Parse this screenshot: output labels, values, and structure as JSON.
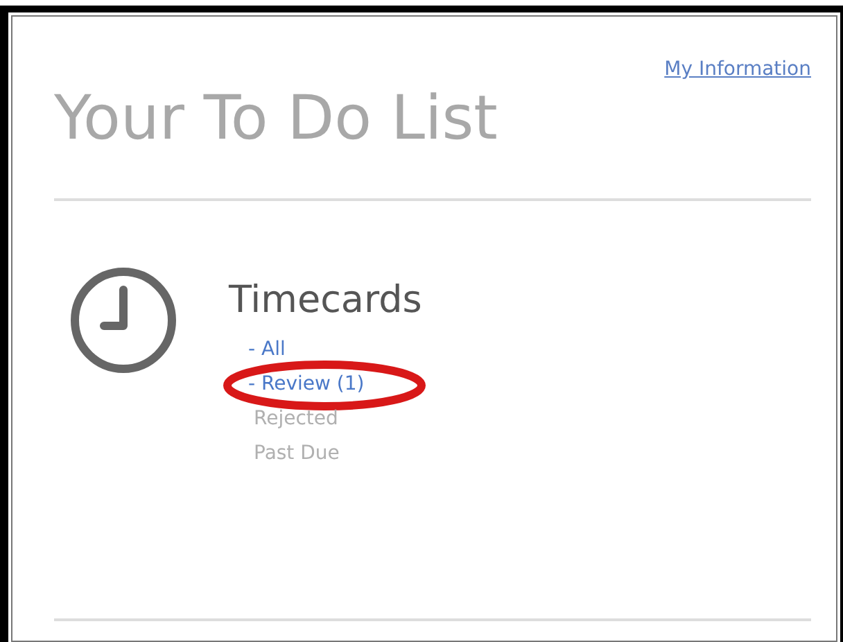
{
  "header": {
    "title": "Your To Do List",
    "link": "My Information"
  },
  "section": {
    "title": "Timecards",
    "items": [
      {
        "label": "- All",
        "link": true,
        "circled": false
      },
      {
        "label": "- Review (1)",
        "link": true,
        "circled": true
      },
      {
        "label": "Rejected",
        "link": false,
        "circled": false
      },
      {
        "label": "Past Due",
        "link": false,
        "circled": false
      }
    ]
  }
}
